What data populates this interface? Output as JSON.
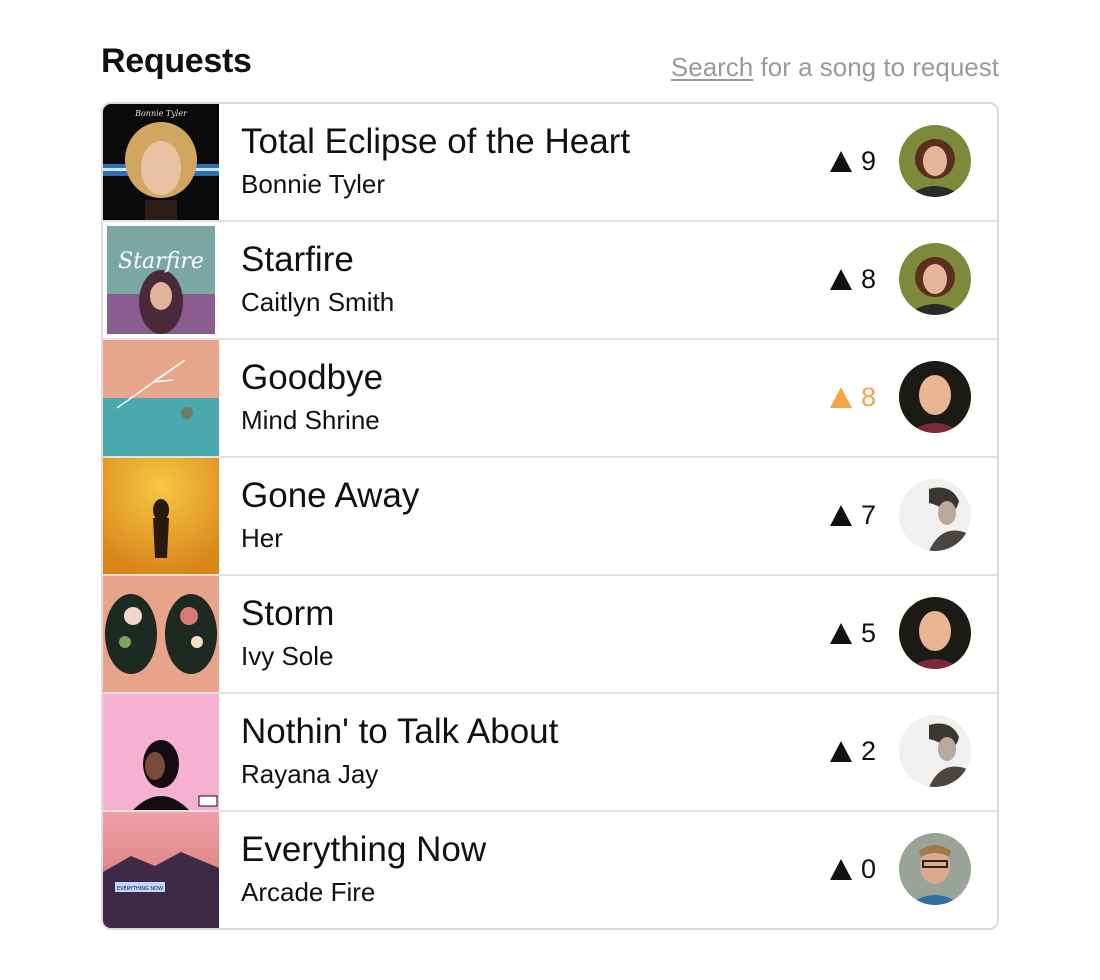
{
  "header": {
    "title": "Requests",
    "search_link": "Search",
    "search_hint": " for a song to request"
  },
  "colors": {
    "upvoted": "#f5a34a",
    "divider": "#e1e1e1"
  },
  "requests": [
    {
      "title": "Total Eclipse of the Heart",
      "artist": "Bonnie Tyler",
      "votes": "9",
      "upvoted": false,
      "art_lettering": "Bonnie Tyler",
      "requester_avatar": "woman-curly-hair"
    },
    {
      "title": "Starfire",
      "artist": "Caitlyn Smith",
      "votes": "8",
      "upvoted": false,
      "art_lettering": "Starfire",
      "requester_avatar": "woman-curly-hair"
    },
    {
      "title": "Goodbye",
      "artist": "Mind Shrine",
      "votes": "8",
      "upvoted": true,
      "art_lettering": "",
      "requester_avatar": "bald-man"
    },
    {
      "title": "Gone Away",
      "artist": "Her",
      "votes": "7",
      "upvoted": false,
      "art_lettering": "",
      "requester_avatar": "man-grayscale"
    },
    {
      "title": "Storm",
      "artist": "Ivy Sole",
      "votes": "5",
      "upvoted": false,
      "art_lettering": "",
      "requester_avatar": "bald-man"
    },
    {
      "title": "Nothin' to Talk About",
      "artist": "Rayana Jay",
      "votes": "2",
      "upvoted": false,
      "art_lettering": "",
      "requester_avatar": "man-grayscale"
    },
    {
      "title": "Everything Now",
      "artist": "Arcade Fire",
      "votes": "0",
      "upvoted": false,
      "art_lettering": "EVERYTHING NOW",
      "requester_avatar": "man-glasses"
    }
  ]
}
